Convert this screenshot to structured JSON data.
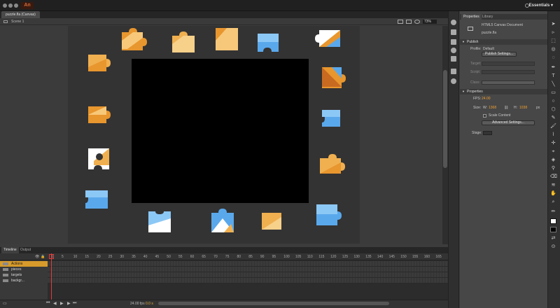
{
  "window": {
    "workspace_label": "Essentials",
    "logo_text": "An"
  },
  "document": {
    "tab_title": "puzzle.fla (Canvas)",
    "scene_label": "Scene 1",
    "zoom": "73%"
  },
  "timeline": {
    "tabs": [
      "Timeline",
      "Output"
    ],
    "layers": [
      "Actions",
      "pieces",
      "targets",
      "backgr..."
    ],
    "frame_numbers": [
      "1",
      "5",
      "10",
      "15",
      "20",
      "25",
      "30",
      "35",
      "40",
      "45",
      "50",
      "55",
      "60",
      "65",
      "70",
      "75",
      "80",
      "85",
      "90",
      "95",
      "100",
      "105",
      "110",
      "115",
      "120",
      "125",
      "130",
      "135",
      "140",
      "145",
      "150",
      "155",
      "160",
      "165"
    ],
    "footer": {
      "fps": "24.00 fps",
      "time": "0.0 s"
    }
  },
  "properties": {
    "tabs": [
      "Properties",
      "Library"
    ],
    "doc_type": "HTML5 Canvas Document",
    "file_name": "puzzle.fla",
    "publish": {
      "header": "Publish",
      "profile_label": "Profile:",
      "profile_value": "Default",
      "settings_button": "Publish Settings...",
      "target_label": "Target:",
      "script_label": "Script:",
      "class_label": "Class:"
    },
    "props": {
      "header": "Properties",
      "fps_label": "FPS:",
      "fps_value": "24.00",
      "size_label": "Size:",
      "w_label": "W:",
      "w_value": "1368",
      "h_label": "H:",
      "h_value": "1038",
      "unit": "px",
      "scale_content": "Scale Content",
      "advanced_button": "Advanced Settings...",
      "stage_label": "Stage:"
    }
  },
  "colors": {
    "orange_piece": "#e8962e",
    "blue_piece": "#5aa8ec",
    "accent": "#f0a030",
    "playhead": "#e03a3a"
  }
}
